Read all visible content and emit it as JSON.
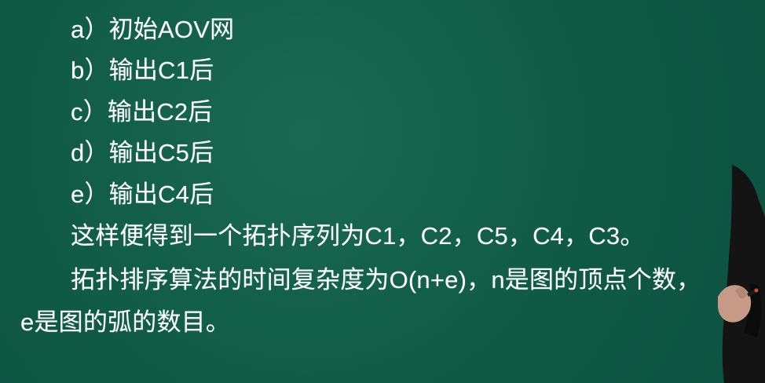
{
  "lines": [
    "a）初始AOV网",
    "b）输出C1后",
    "c）输出C2后",
    "d）输出C5后",
    "e）输出C4后",
    "这样便得到一个拓扑序列为C1，C2，C5，C4，C3。",
    "拓扑排序算法的时间复杂度为O(n+e)，n是图的顶点个数，",
    "e是图的弧的数目。"
  ]
}
